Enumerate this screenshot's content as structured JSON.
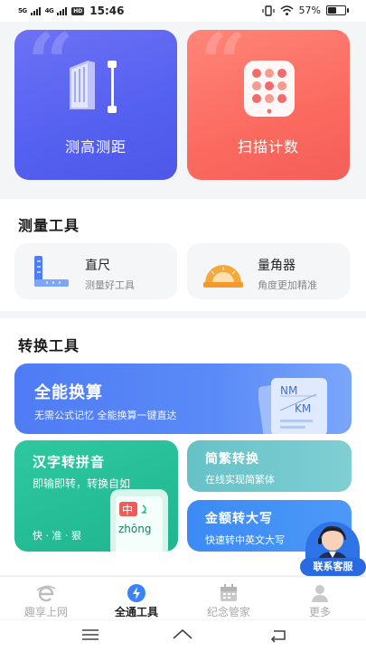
{
  "status_bar": {
    "signal1": "5G",
    "signal2": "4G",
    "hd": "HD",
    "time": "15:46",
    "battery": "57%",
    "battery_level": 0.57
  },
  "top_cards": [
    {
      "label": "测高测距",
      "icon": "height-measure-icon",
      "color": "#5a63f0"
    },
    {
      "label": "扫描计数",
      "icon": "scan-count-icon",
      "color": "#fb6a5f"
    }
  ],
  "measure_section": {
    "title": "测量工具",
    "tools": [
      {
        "title": "直尺",
        "subtitle": "测量好工具",
        "icon": "ruler-icon"
      },
      {
        "title": "量角器",
        "subtitle": "角度更加精准",
        "icon": "protractor-icon"
      }
    ]
  },
  "convert_section": {
    "title": "转换工具",
    "all_convert": {
      "title": "全能换算",
      "subtitle": "无需公式记忆  全能换算一键直达",
      "badge_top": "NM",
      "badge_bottom": "KM"
    },
    "pinyin": {
      "title": "汉字转拼音",
      "subtitle": "即输即转，转换自如",
      "motto": "快 · 准 · 狠",
      "char": "中",
      "pinyin": "zhōng"
    },
    "traditional": {
      "title": "简繁转换",
      "subtitle": "在线实现简繁体"
    },
    "amount": {
      "title": "金额转大写",
      "subtitle": "快速转中英文大写"
    }
  },
  "support": {
    "label": "联系客服"
  },
  "tabbar": {
    "tabs": [
      {
        "label": "趣享上网",
        "icon": "browser-icon",
        "active": false
      },
      {
        "label": "全通工具",
        "icon": "tools-icon",
        "active": true
      },
      {
        "label": "纪念管家",
        "icon": "calendar-icon",
        "active": false
      },
      {
        "label": "更多",
        "icon": "person-icon",
        "active": false
      }
    ]
  },
  "colors": {
    "accent_blue": "#3c8af5",
    "accent_green": "#1fb58f",
    "accent_red": "#fb6a5f",
    "active_tab": "#3b82f6"
  }
}
